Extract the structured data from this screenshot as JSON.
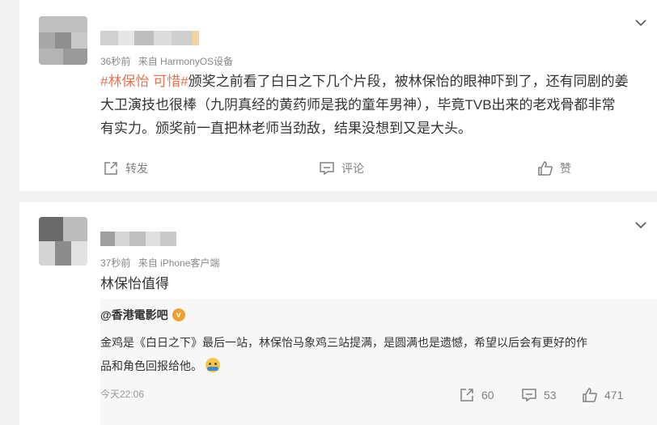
{
  "posts": [
    {
      "meta": {
        "time": "36秒前",
        "source": "来自 HarmonyOS设备"
      },
      "content": {
        "hashtag": "#林保怡 可惜#",
        "line1_rest": "颁奖之前看了白日之下几个片段，被林保怡的眼神吓到了，还有同剧的姜",
        "line2": "大卫演技也很棒（九阴真经的黄药师是我的童年男神），毕竟TVB出来的老戏骨都非常",
        "line3": "有实力。颁奖前一直把林老师当劲敌，结果没想到又是大头。"
      },
      "actions": {
        "repost": "转发",
        "comment": "评论",
        "like": "赞"
      }
    },
    {
      "meta": {
        "time": "37秒前",
        "source": "来自 iPhone客户端"
      },
      "content": {
        "text": "林保怡值得"
      },
      "repost": {
        "author": "@香港電影吧",
        "verified_badge": "v",
        "text_line1": "金鸡是《白日之下》最后一站，林保怡马象鸡三站提满，是圆满也是遗憾，希望以后会有更好的作",
        "text_line2": "品和角色回报给他。",
        "time": "今天22:06",
        "stats": {
          "reposts": "60",
          "comments": "53",
          "likes": "471"
        }
      }
    }
  ],
  "colors": {
    "hashtag": "#eb7350",
    "text": "#333333",
    "meta": "#888888",
    "action": "#808080",
    "background": "#f2f2f2",
    "repost_bg": "#f7f7f7"
  },
  "icons": {
    "more": "chevron-down-icon",
    "repost": "share-icon",
    "comment": "comment-icon",
    "like": "thumbs-up-icon"
  }
}
